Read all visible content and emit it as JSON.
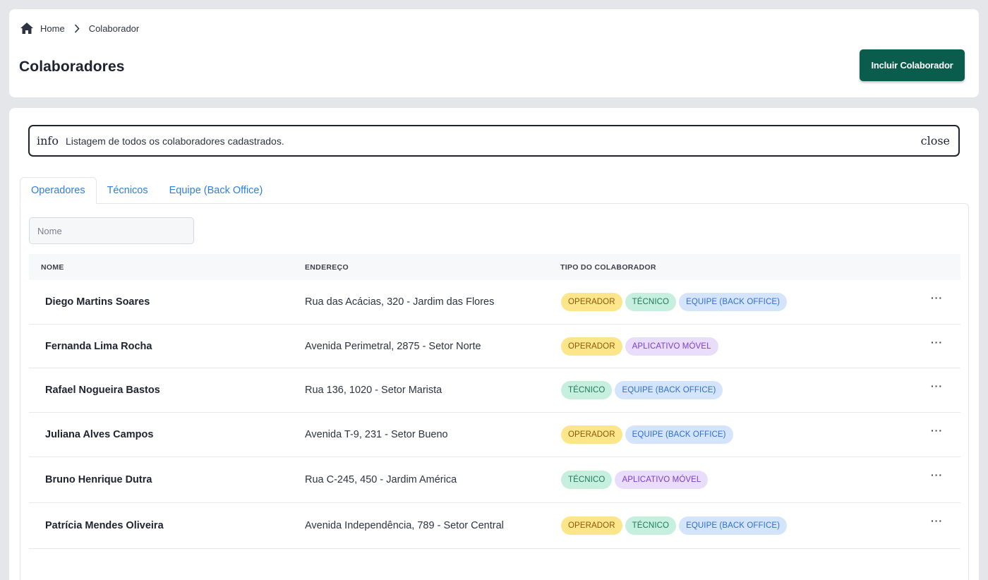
{
  "breadcrumb": {
    "home": "Home",
    "current": "Colaborador"
  },
  "page": {
    "title": "Colaboradores",
    "add_button": "Incluir Colaborador"
  },
  "alert": {
    "icon": "info",
    "text": "Listagem de todos os colaboradores cadastrados.",
    "close": "close"
  },
  "tabs": [
    {
      "label": "Operadores"
    },
    {
      "label": "Técnicos"
    },
    {
      "label": "Equipe (Back Office)"
    }
  ],
  "search": {
    "placeholder": "Nome"
  },
  "table": {
    "headers": {
      "name": "NOME",
      "address": "ENDEREÇO",
      "type": "TIPO DO COLABORADOR"
    },
    "rows": [
      {
        "name": "Diego Martins Soares",
        "address": "Rua das Acácias, 320 - Jardim das Flores",
        "types": [
          "OPERADOR",
          "TÉCNICO",
          "EQUIPE (BACK OFFICE)"
        ]
      },
      {
        "name": "Fernanda Lima Rocha",
        "address": "Avenida Perimetral, 2875 - Setor Norte",
        "types": [
          "OPERADOR",
          "APLICATIVO MÓVEL"
        ]
      },
      {
        "name": "Rafael Nogueira Bastos",
        "address": "Rua 136, 1020 - Setor Marista",
        "types": [
          "TÉCNICO",
          "EQUIPE (BACK OFFICE)"
        ]
      },
      {
        "name": "Juliana Alves Campos",
        "address": "Avenida T-9, 231 - Setor Bueno",
        "types": [
          "OPERADOR",
          "EQUIPE (BACK OFFICE)"
        ]
      },
      {
        "name": "Bruno Henrique Dutra",
        "address": "Rua C-245, 450 - Jardim América",
        "types": [
          "TÉCNICO",
          "APLICATIVO MÓVEL"
        ]
      },
      {
        "name": "Patrícia Mendes Oliveira",
        "address": "Avenida Independência, 789 - Setor Central",
        "types": [
          "OPERADOR",
          "TÉCNICO",
          "EQUIPE (BACK OFFICE)"
        ]
      }
    ],
    "row_action": "···"
  },
  "colors": {
    "accent": "#0a5c4c",
    "link": "#2f7de1",
    "badge_operador": "#fde58a",
    "badge_tecnico": "#c6efdf",
    "badge_equipe": "#d4e5fb",
    "badge_app": "#eadcfb"
  }
}
